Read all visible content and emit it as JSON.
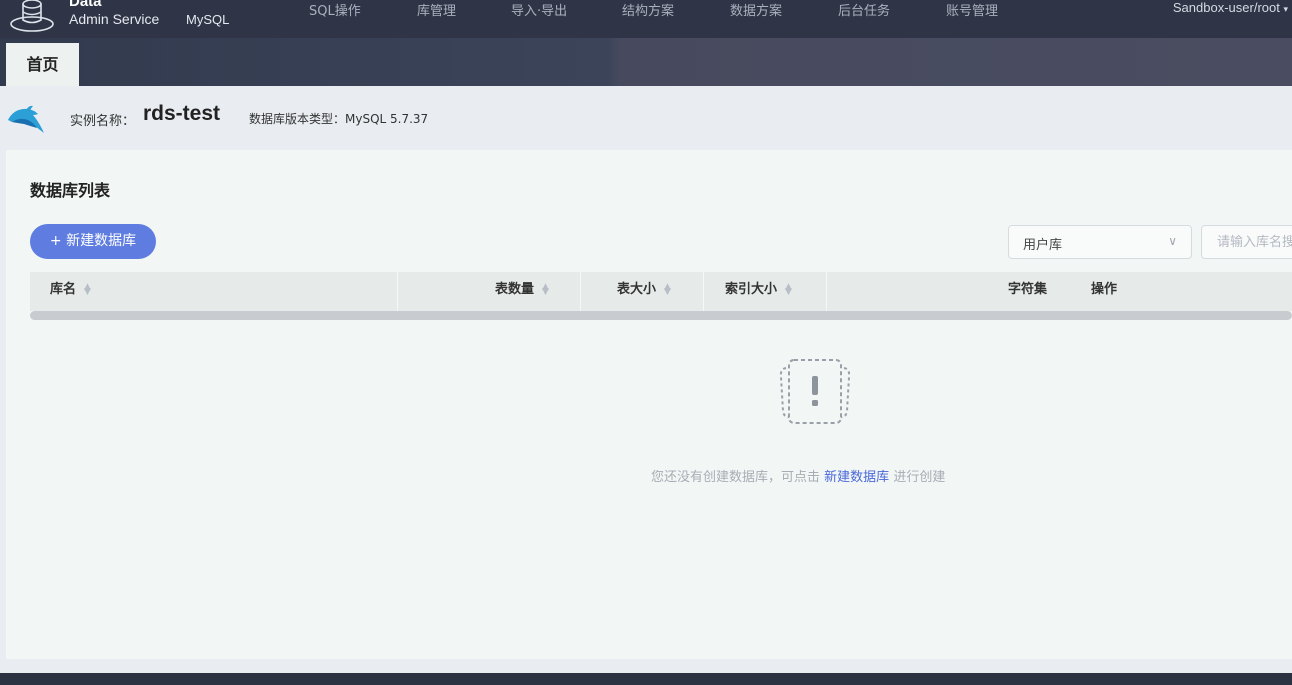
{
  "nav": {
    "brand_top": "Data",
    "brand_bottom": "Admin Service",
    "brand_db": "MySQL",
    "items": [
      "SQL操作",
      "库管理",
      "导入·导出",
      "结构方案",
      "数据方案",
      "后台任务",
      "账号管理"
    ],
    "user": "Sandbox-user/root"
  },
  "tabs": {
    "home": "首页"
  },
  "instance": {
    "label": "实例名称：",
    "name": "rds-test",
    "version": "数据库版本类型：MySQL 5.7.37"
  },
  "list": {
    "title": "数据库列表",
    "add_button": "+ 新建数据库",
    "filter_selected": "用户库",
    "search_placeholder": "请输入库名搜索",
    "columns": [
      "库名",
      "表数量",
      "表大小",
      "索引大小",
      "字符集",
      "操作"
    ],
    "empty": {
      "before": "您还没有创建数据库，可点击",
      "link": "新建数据库",
      "after": "进行创建"
    }
  },
  "colors": {
    "nav_bg": "#2f3547",
    "accent": "#5f7de0",
    "link": "#4a68d8"
  }
}
